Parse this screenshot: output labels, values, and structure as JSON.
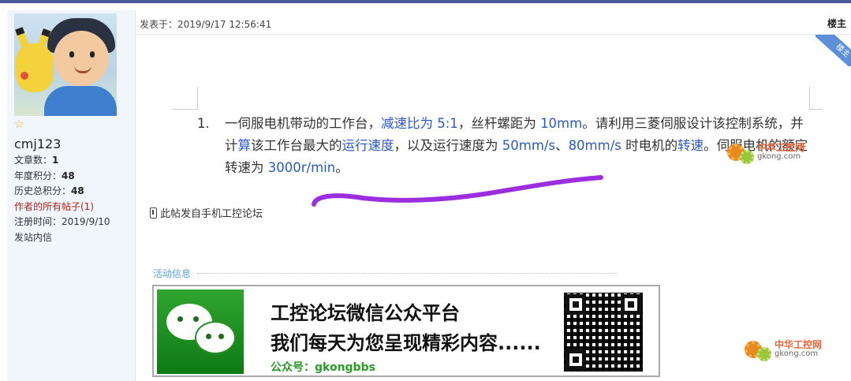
{
  "user": {
    "username": "cmj123",
    "stats": [
      {
        "label": "文章数：",
        "value": "1"
      },
      {
        "label": "年度积分：",
        "value": "48"
      },
      {
        "label": "历史总积分：",
        "value": "48"
      }
    ],
    "all_posts_link": "作者的所有帖子(1)",
    "registered_label": "注册时间：",
    "registered_value": "2019/9/10",
    "send_message": "发站内信",
    "rank_icon": "star-icon"
  },
  "post": {
    "date": "发表于：2019/9/17 12:56:41",
    "floor": "楼主",
    "corner_badge": "楼主",
    "question": {
      "number": "1.",
      "segments": [
        {
          "text": "一伺服电机带动的工作台，",
          "blue": false
        },
        {
          "text": "减速比为 5:1",
          "blue": true
        },
        {
          "text": "，丝杆螺距为 ",
          "blue": false
        },
        {
          "text": "10mm",
          "blue": true
        },
        {
          "text": "。请利用三菱伺服设计该控制系统，并计",
          "blue": false
        },
        {
          "text": "算",
          "blue": true
        },
        {
          "text": "该工作台最大的",
          "blue": false
        },
        {
          "text": "运行速度",
          "blue": true
        },
        {
          "text": "，以及运行速度为 ",
          "blue": false
        },
        {
          "text": "50mm/s",
          "blue": true
        },
        {
          "text": "、",
          "blue": false
        },
        {
          "text": "80mm/s",
          "blue": true
        },
        {
          "text": " 时电机的",
          "blue": false
        },
        {
          "text": "转速",
          "blue": true
        },
        {
          "text": "。伺服电机的额定转速为 ",
          "blue": false
        },
        {
          "text": "3000r/min",
          "blue": true
        },
        {
          "text": "。",
          "blue": false
        }
      ]
    },
    "mobile_note": "此帖发自手机工控论坛"
  },
  "activity": {
    "label": "活动信息",
    "banner_line1": "工控论坛微信公众平台",
    "banner_line2": "我们每天为您呈现精彩内容......",
    "banner_line3": "公众号：gkongbbs"
  },
  "watermark": {
    "cn": "中华工控网",
    "en": "gkong.com"
  },
  "colors": {
    "accent_blue": "#2c59c6",
    "link_red": "#b5201a",
    "scribble": "#9b2fe0"
  }
}
